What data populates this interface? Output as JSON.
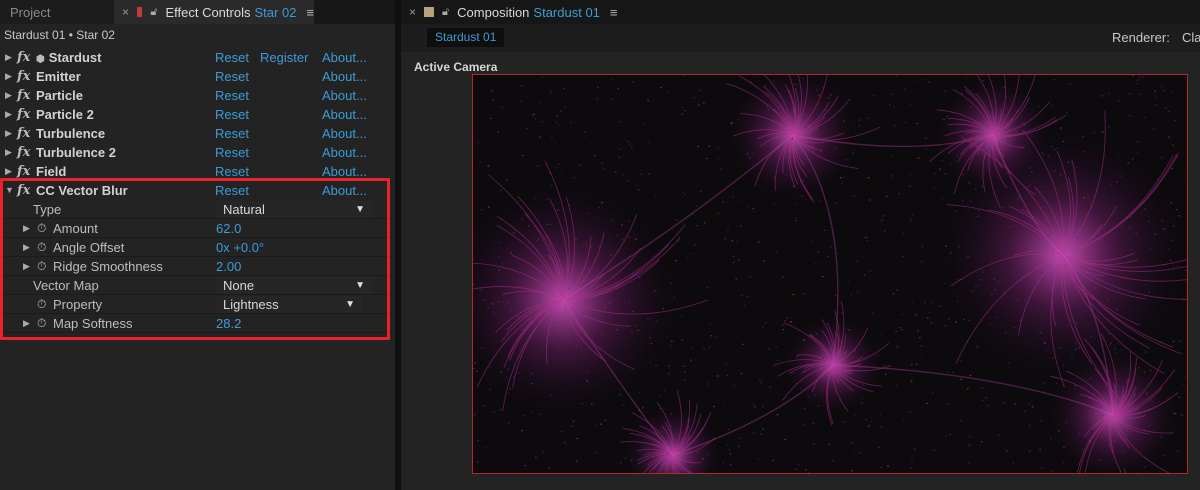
{
  "left_tabs": {
    "project_label": "Project",
    "effect_controls_label": "Effect Controls",
    "effect_controls_layer": "Star 02",
    "close_glyph": "×",
    "menu_glyph": "≡",
    "swatch_color": "#c0393b"
  },
  "breadcrumb": "Stardust 01 • Star 02",
  "effects": [
    {
      "name": "Stardust",
      "reset": "Reset",
      "register": "Register",
      "about": "About..."
    },
    {
      "name": "Emitter",
      "reset": "Reset",
      "about": "About..."
    },
    {
      "name": "Particle",
      "reset": "Reset",
      "about": "About..."
    },
    {
      "name": "Particle 2",
      "reset": "Reset",
      "about": "About..."
    },
    {
      "name": "Turbulence",
      "reset": "Reset",
      "about": "About..."
    },
    {
      "name": "Turbulence 2",
      "reset": "Reset",
      "about": "About..."
    },
    {
      "name": "Field",
      "reset": "Reset",
      "about": "About..."
    },
    {
      "name": "CC Vector Blur",
      "reset": "Reset",
      "about": "About..."
    }
  ],
  "fx_glyph": "fx",
  "vector_blur": {
    "type_label": "Type",
    "type_value": "Natural",
    "amount_label": "Amount",
    "amount_value": "62.0",
    "angle_label": "Angle Offset",
    "angle_value": "0x +0.0°",
    "ridge_label": "Ridge Smoothness",
    "ridge_value": "2.00",
    "vector_map_label": "Vector Map",
    "vector_map_value": "None",
    "property_label": "Property",
    "property_value": "Lightness",
    "softness_label": "Map Softness",
    "softness_value": "28.2"
  },
  "right_tabs": {
    "composition_label": "Composition",
    "composition_name": "Stardust 01",
    "swatch_color": "#b8a27e"
  },
  "comp_chip": "Stardust 01",
  "renderer_label": "Renderer:",
  "renderer_value": "Cla",
  "camera_label": "Active Camera",
  "colors": {
    "accent": "#3e9bd6",
    "highlight": "#e8232e",
    "particles": "#b0308c"
  }
}
